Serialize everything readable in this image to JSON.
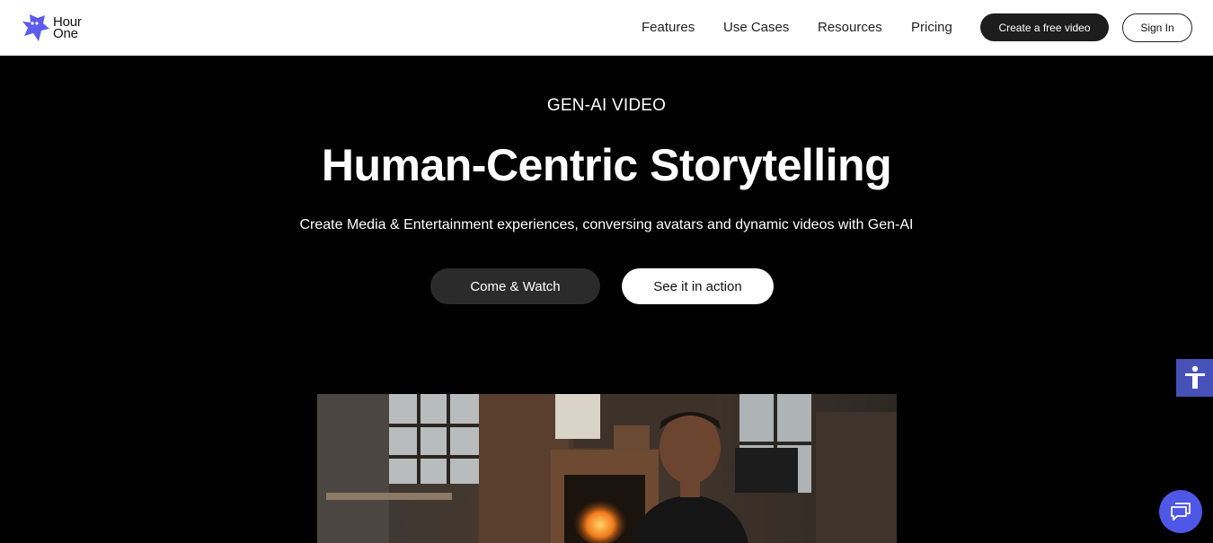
{
  "brand": {
    "line1": "Hour",
    "line2": "One",
    "accent_color": "#5b5bf0"
  },
  "nav": {
    "items": [
      {
        "label": "Features"
      },
      {
        "label": "Use Cases"
      },
      {
        "label": "Resources"
      },
      {
        "label": "Pricing"
      }
    ],
    "create_label": "Create a free video",
    "signin_label": "Sign In"
  },
  "hero": {
    "eyebrow": "GEN-AI VIDEO",
    "title": "Human-Centric Storytelling",
    "subtitle": "Create Media & Entertainment experiences, conversing avatars and dynamic videos with Gen-AI",
    "primary_cta": "Come & Watch",
    "secondary_cta": "See it in action"
  },
  "widgets": {
    "accessibility_icon": "accessibility-icon",
    "chat_icon": "chat-icon",
    "accessibility_color": "#4752b8",
    "chat_color": "#4f57e6"
  }
}
